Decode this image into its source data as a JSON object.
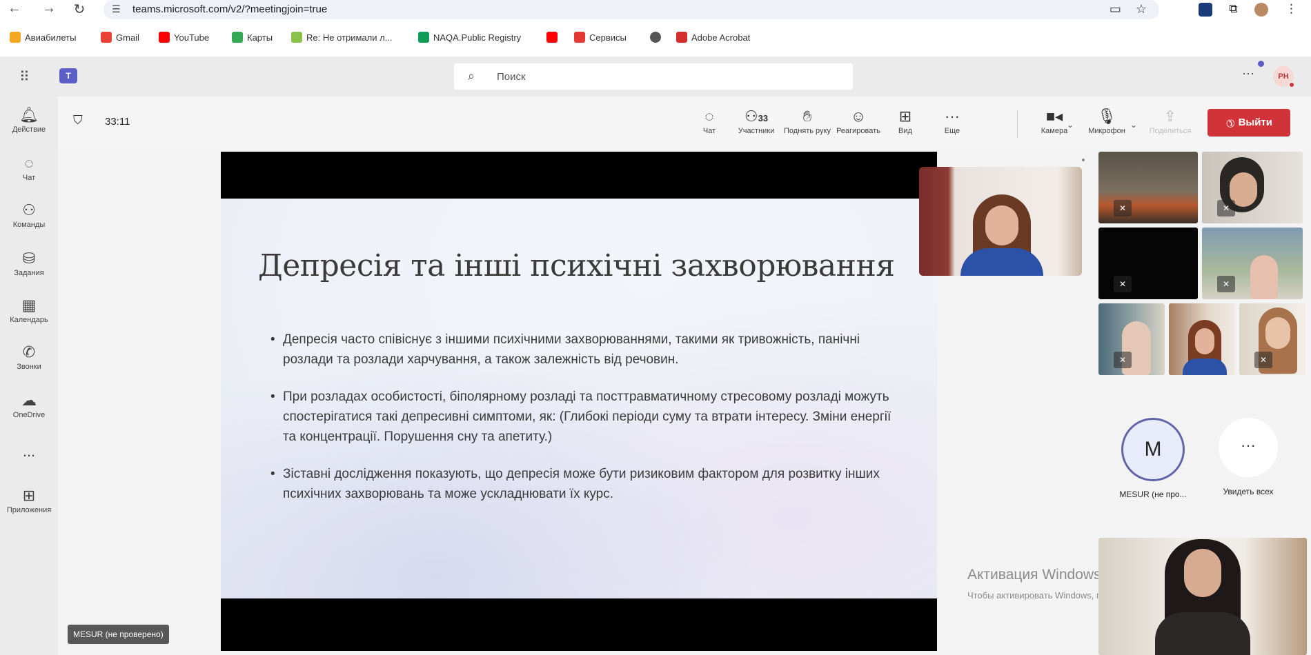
{
  "browser": {
    "url": "teams.microsoft.com/v2/?meetingjoin=true",
    "bookmarks": [
      {
        "label": "Авиабилеты",
        "icon": "aviasales-icon",
        "color": "#f5a623"
      },
      {
        "label": "Gmail",
        "icon": "gmail-icon",
        "color": "#ea4335"
      },
      {
        "label": "YouTube",
        "icon": "youtube-icon",
        "color": "#ff0000"
      },
      {
        "label": "Карты",
        "icon": "maps-icon",
        "color": "#34a853"
      },
      {
        "label": "Re: Не отримали л...",
        "icon": "mail-icon",
        "color": "#8bc34a"
      },
      {
        "label": "NAQA.Public Registry",
        "icon": "sheets-icon",
        "color": "#0f9d58"
      },
      {
        "label": "",
        "icon": "youtube-icon",
        "color": "#ff0000"
      },
      {
        "label": "Сервисы",
        "icon": "services-icon",
        "color": "#e53935"
      },
      {
        "label": "",
        "icon": "globe-icon",
        "color": "#555555"
      },
      {
        "label": "Adobe Acrobat",
        "icon": "acrobat-icon",
        "color": "#d32f2f"
      }
    ]
  },
  "teams": {
    "search_placeholder": "Поиск",
    "user_initials": "PH",
    "rail": [
      {
        "label": "Действие",
        "icon": "bell-icon"
      },
      {
        "label": "Чат",
        "icon": "chat-icon"
      },
      {
        "label": "Команды",
        "icon": "teams-icon"
      },
      {
        "label": "Задания",
        "icon": "backpack-icon"
      },
      {
        "label": "Календарь",
        "icon": "calendar-icon"
      },
      {
        "label": "Звонки",
        "icon": "phone-icon"
      },
      {
        "label": "OneDrive",
        "icon": "cloud-icon"
      },
      {
        "label": "...",
        "icon": "more-icon"
      },
      {
        "label": "Приложения",
        "icon": "apps-icon"
      }
    ]
  },
  "meeting": {
    "timer": "33:11",
    "controls": {
      "chat": "Чат",
      "participants": "Участники",
      "participants_count": "33",
      "raise_hand": "Поднять руку",
      "react": "Реагировать",
      "view": "Вид",
      "more": "Еще",
      "camera": "Камера",
      "mic": "Микрофон",
      "share": "Поделиться",
      "leave": "Выйти"
    },
    "presenter_name_tag": "MESUR (не проверено)",
    "slide": {
      "title": "Депресія та інші психічні захворювання",
      "bullets": [
        "Депресія часто співіснує з іншими психічними захворюваннями, такими як тривожність, панічні розлади та розлади харчування, а також залежність від речовин.",
        "При розладах особистості, біполярному розладі та посттравматичному стресовому розладі можуть спостерігатися такі депресивні симптоми, як: (Глибокі періоди суму та втрати інтересу. Зміни енергії та концентрації. Порушення сну та апетиту.)",
        "Зіставні дослідження показують, що депресія може бути ризиковим фактором для розвитку інших психічних захворювань та може ускладнювати їх курс."
      ]
    },
    "gallery": {
      "avatar_initial": "M",
      "avatar_name": "MESUR (не про...",
      "see_all": "Увидеть всех"
    }
  },
  "os_watermark": {
    "title": "Активация Windows",
    "text": "Чтобы активировать Windows, перейдите в раздел \"Параметры\"."
  },
  "colors": {
    "leave": "#d13438",
    "teams_accent": "#5b5fc7"
  }
}
